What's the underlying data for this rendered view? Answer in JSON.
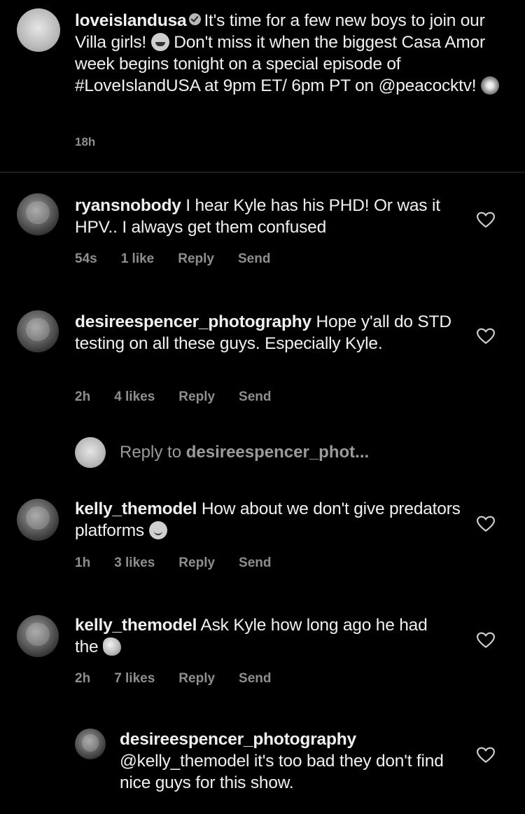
{
  "caption": {
    "username": "loveislandusa",
    "text_part1": "It's time for a few new boys to join our Villa girls!",
    "text_part2": "Don't miss it when the biggest Casa Amor week begins tonight on a special episode of #LoveIslandUSA at 9pm ET/ 6pm PT on @peacocktv!",
    "time": "18h"
  },
  "comments": [
    {
      "username": "ryansnobody",
      "text": "I hear Kyle has his PHD! Or was it HPV.. I always get them confused",
      "time": "54s",
      "likes": "1 like",
      "reply_label": "Reply",
      "send_label": "Send"
    },
    {
      "username": "desireespencer_photography",
      "text": "Hope y'all do STD testing on all these guys. Especially Kyle.",
      "time": "2h",
      "likes": "4 likes",
      "reply_label": "Reply",
      "send_label": "Send"
    },
    {
      "username": "kelly_themodel",
      "text": "How about we don't give predators platforms",
      "time": "1h",
      "likes": "3 likes",
      "reply_label": "Reply",
      "send_label": "Send"
    },
    {
      "username": "kelly_themodel",
      "text": "Ask Kyle how long ago he had the",
      "time": "2h",
      "likes": "7 likes",
      "reply_label": "Reply",
      "send_label": "Send"
    }
  ],
  "reply_prompt": {
    "label": "Reply to",
    "target": "desireespencer_phot..."
  },
  "nested_reply": {
    "username": "desireespencer_photography",
    "text": "@kelly_themodel it's too bad they don't find nice guys for this show."
  },
  "colors": {
    "background": "#000000",
    "text": "#f0f0f0",
    "meta": "#8e8e8e"
  }
}
